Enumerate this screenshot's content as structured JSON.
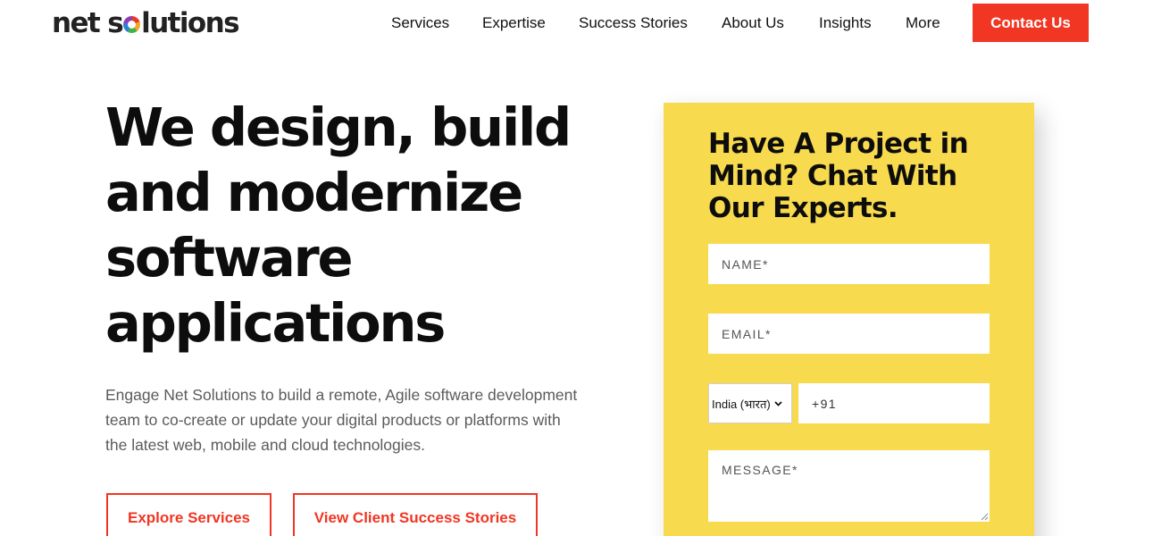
{
  "header": {
    "logo_prefix": "net s",
    "logo_suffix": "lutions",
    "nav": [
      "Services",
      "Expertise",
      "Success Stories",
      "About Us",
      "Insights",
      "More"
    ],
    "contact_label": "Contact Us"
  },
  "hero": {
    "title_lines": [
      "We design, build",
      "and modernize",
      "software",
      "applications"
    ],
    "description": "Engage Net Solutions to build a remote, Agile software development team to co-create or update your digital products or platforms with the latest web, mobile and cloud technologies.",
    "explore_label": "Explore Services",
    "stories_label": "View Client Success Stories"
  },
  "form": {
    "title": "Have A Project in Mind? Chat With Our Experts.",
    "name_placeholder": "NAME*",
    "email_placeholder": "EMAIL*",
    "country_value": "India (भारत)",
    "phone_value": "+91",
    "message_placeholder": "MESSAGE*"
  },
  "colors": {
    "accent": "#f13623",
    "form_bg": "#f8da4f"
  },
  "icons": {
    "logo_mark": "ring-icon",
    "country_dropdown": "chevron-down-icon"
  }
}
